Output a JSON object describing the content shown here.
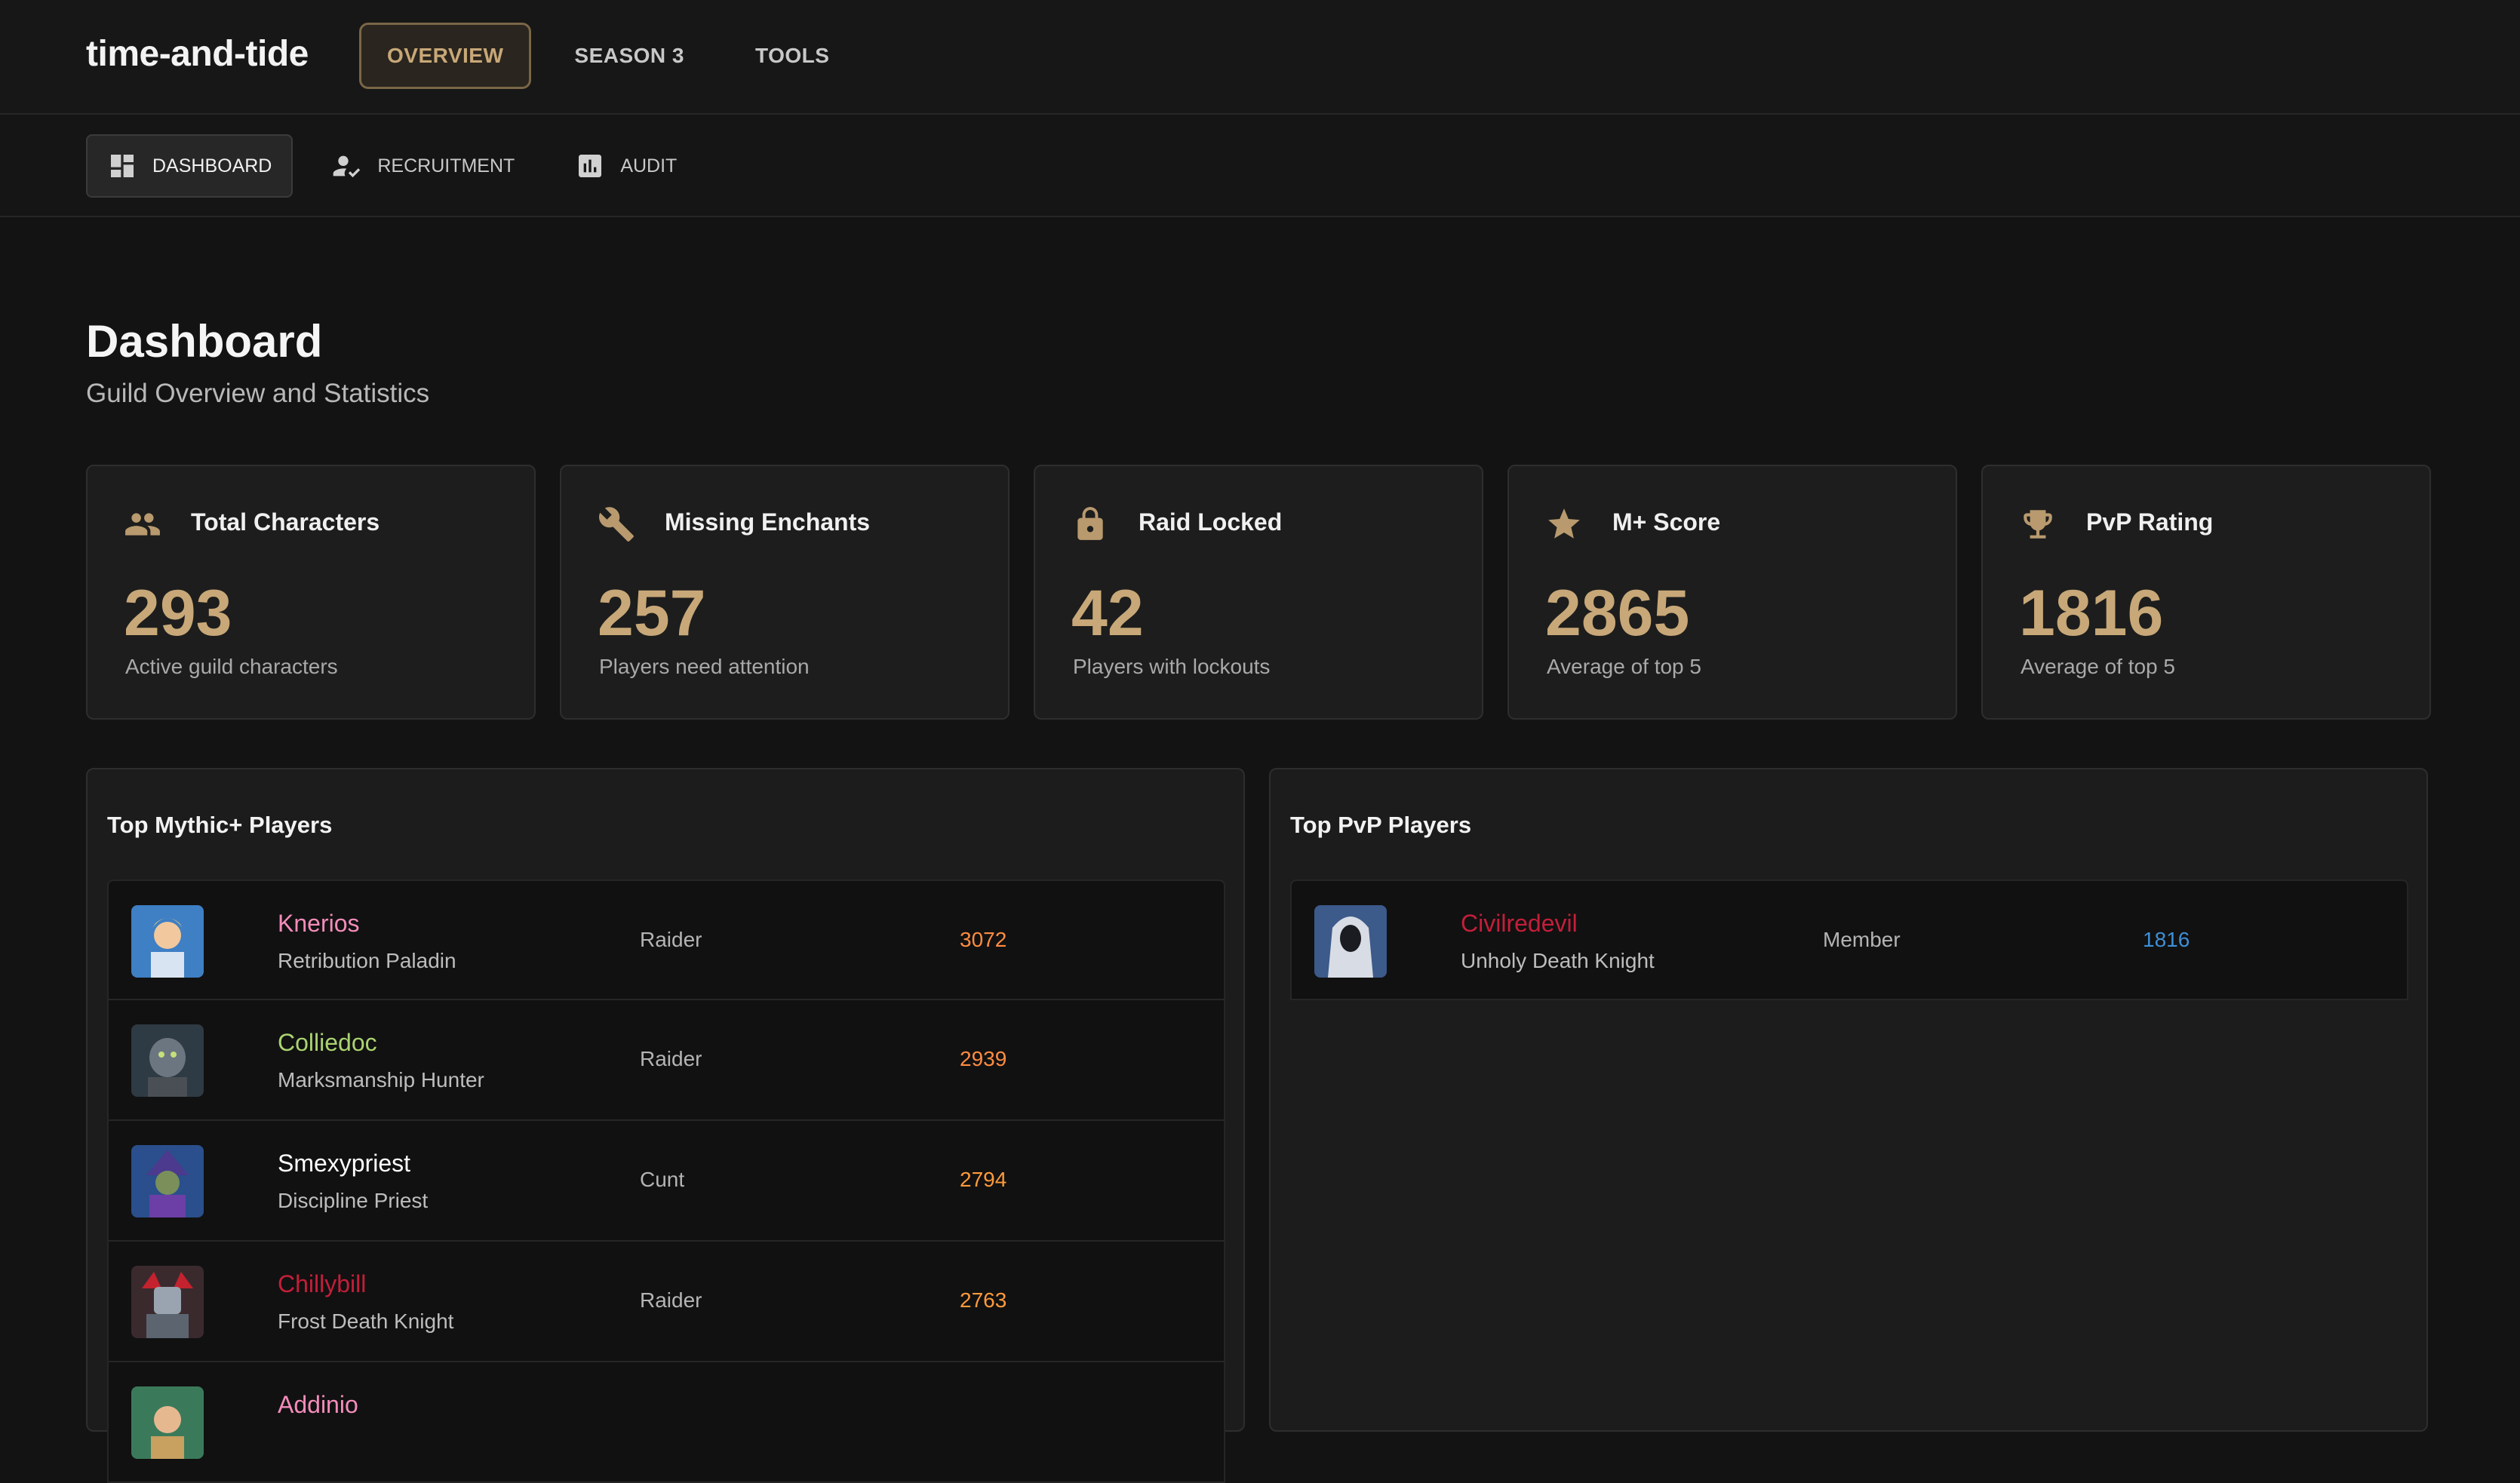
{
  "app": {
    "title": "time-and-tide"
  },
  "topnav": [
    {
      "label": "OVERVIEW",
      "active": true
    },
    {
      "label": "SEASON 3",
      "active": false
    },
    {
      "label": "TOOLS",
      "active": false
    }
  ],
  "subnav": [
    {
      "label": "DASHBOARD",
      "icon": "dashboard-icon",
      "active": true
    },
    {
      "label": "RECRUITMENT",
      "icon": "person-check-icon",
      "active": false
    },
    {
      "label": "AUDIT",
      "icon": "bar-chart-icon",
      "active": false
    }
  ],
  "page": {
    "title": "Dashboard",
    "subtitle": "Guild Overview and Statistics"
  },
  "stats": [
    {
      "title": "Total Characters",
      "value": "293",
      "desc": "Active guild characters",
      "icon": "people-icon"
    },
    {
      "title": "Missing Enchants",
      "value": "257",
      "desc": "Players need attention",
      "icon": "wrench-icon"
    },
    {
      "title": "Raid Locked",
      "value": "42",
      "desc": "Players with lockouts",
      "icon": "lock-icon"
    },
    {
      "title": "M+ Score",
      "value": "2865",
      "desc": "Average of top 5",
      "icon": "star-icon"
    },
    {
      "title": "PvP Rating",
      "value": "1816",
      "desc": "Average of top 5",
      "icon": "trophy-icon"
    }
  ],
  "mythic": {
    "title": "Top Mythic+ Players",
    "players": [
      {
        "name": "Knerios",
        "spec": "Retribution Paladin",
        "rank": "Raider",
        "score": "3072",
        "name_color": "#f48cba",
        "score_color": "#ff8c42"
      },
      {
        "name": "Colliedoc",
        "spec": "Marksmanship Hunter",
        "rank": "Raider",
        "score": "2939",
        "name_color": "#aad372",
        "score_color": "#ff8c42"
      },
      {
        "name": "Smexypriest",
        "spec": "Discipline Priest",
        "rank": "Cunt",
        "score": "2794",
        "name_color": "#ffffff",
        "score_color": "#ff9a3c"
      },
      {
        "name": "Chillybill",
        "spec": "Frost Death Knight",
        "rank": "Raider",
        "score": "2763",
        "name_color": "#c41e3a",
        "score_color": "#ff9a3c"
      },
      {
        "name": "Addinio",
        "spec": "",
        "rank": "",
        "score": "",
        "name_color": "#f48cba",
        "score_color": "#ff9a3c"
      }
    ]
  },
  "pvp": {
    "title": "Top PvP Players",
    "players": [
      {
        "name": "Civilredevil",
        "spec": "Unholy Death Knight",
        "rank": "Member",
        "score": "1816",
        "name_color": "#c41e3a",
        "score_color": "#3e8fd6"
      }
    ]
  },
  "colors": {
    "accent": "#c8a878",
    "background": "#131313",
    "card": "#1d1d1d"
  }
}
